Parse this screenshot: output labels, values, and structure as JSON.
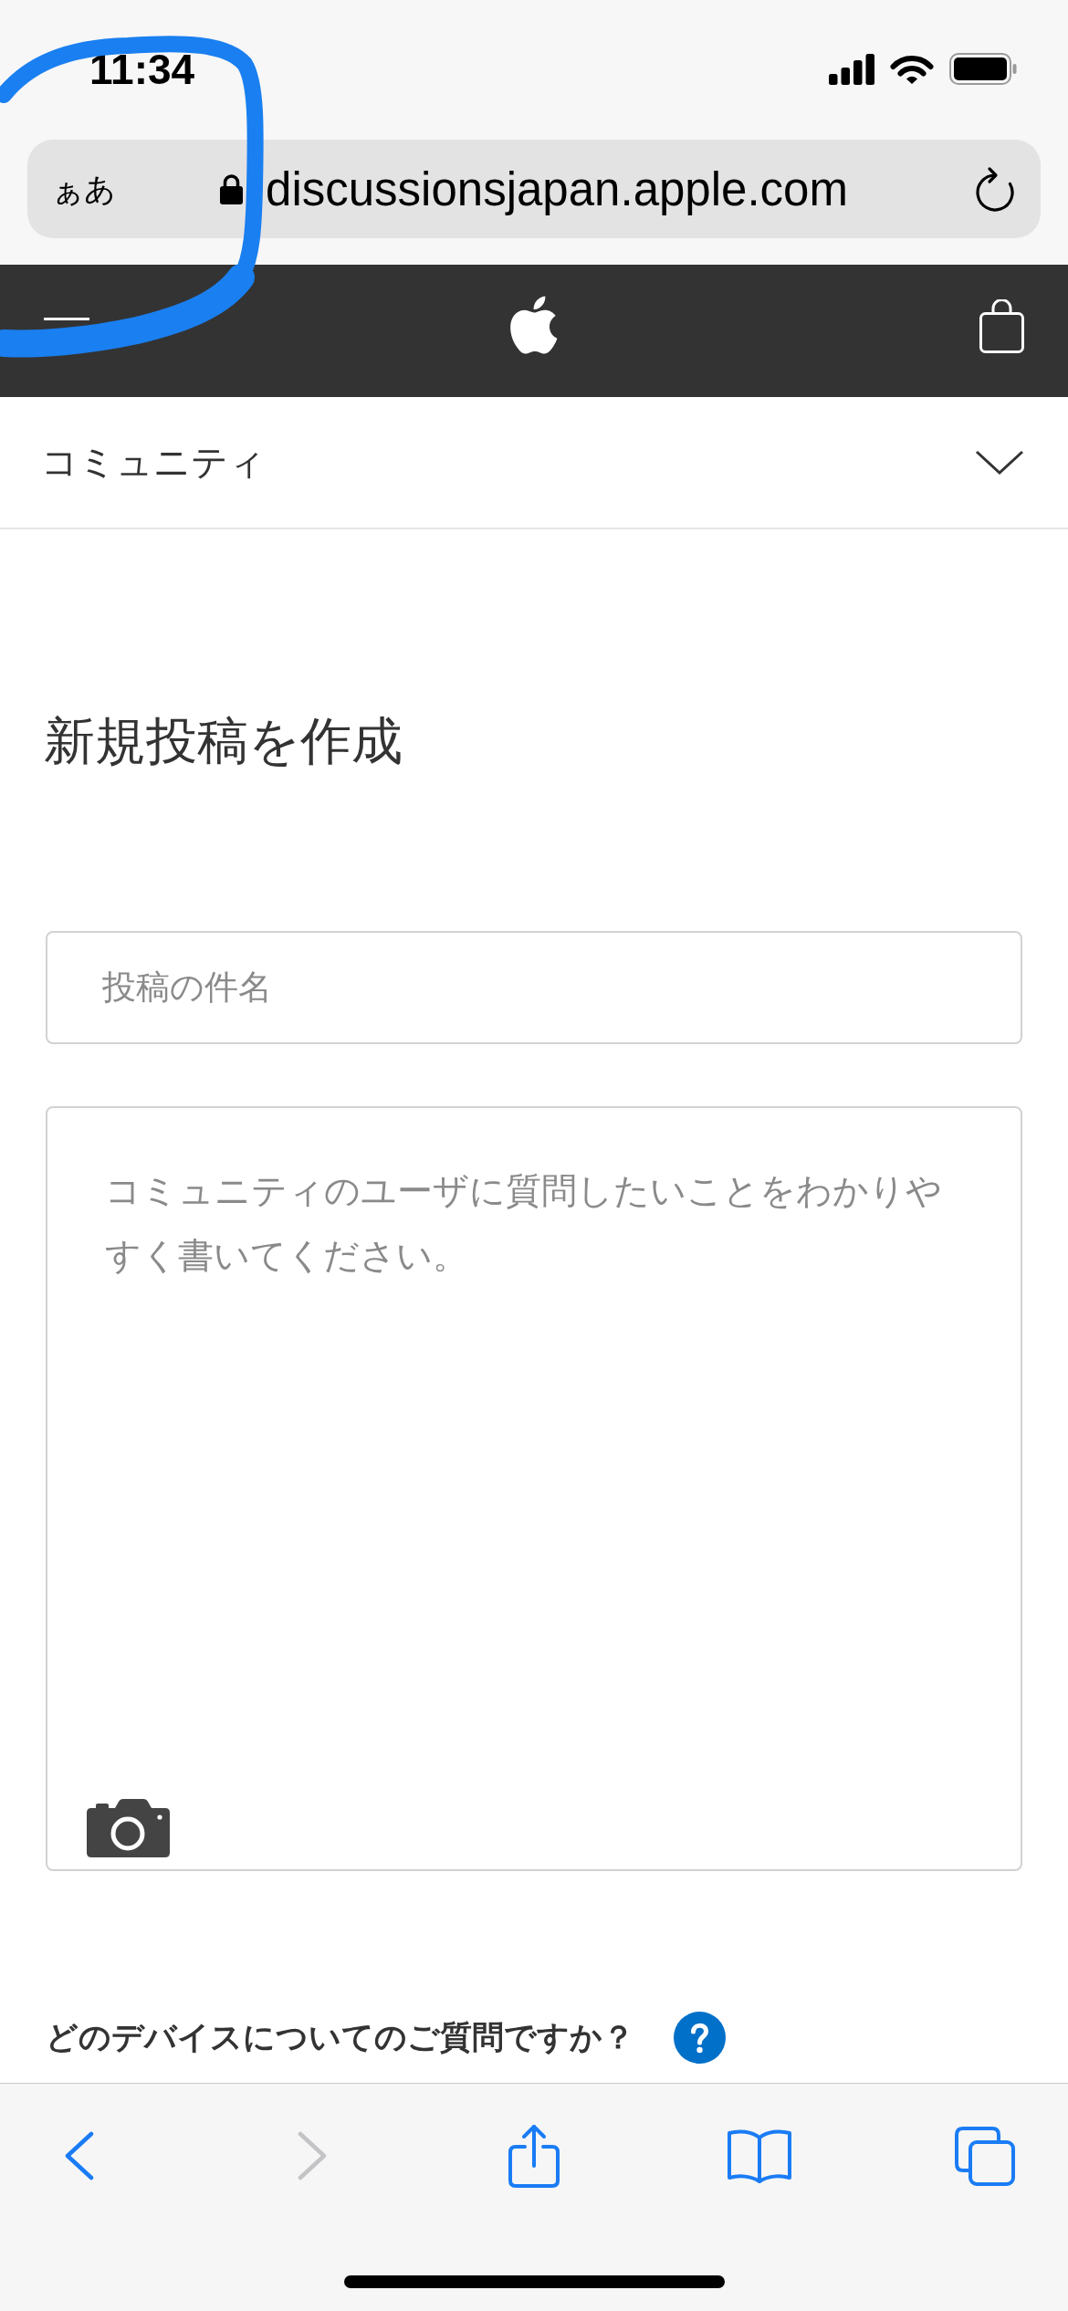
{
  "status_bar": {
    "time": "11:34"
  },
  "address_bar": {
    "text_size_button": "ぁあ",
    "url": "discussionsjapan.apple.com"
  },
  "community_bar": {
    "title": "コミュニティ",
    "expanded": false
  },
  "compose": {
    "heading": "新規投稿を作成",
    "subject": {
      "placeholder": "投稿の件名"
    },
    "body": {
      "placeholder": "コミュニティのユーザに質問したいことをわかりやすく書いてください。"
    },
    "device_question": "どのデバイスについてのご質問ですか？"
  },
  "toolbar": [
    {
      "kind": "back",
      "disabled": false
    },
    {
      "kind": "forward",
      "disabled": true
    },
    {
      "kind": "share",
      "disabled": false
    },
    {
      "kind": "bookmarks",
      "disabled": false
    },
    {
      "kind": "tabs",
      "disabled": false
    }
  ]
}
